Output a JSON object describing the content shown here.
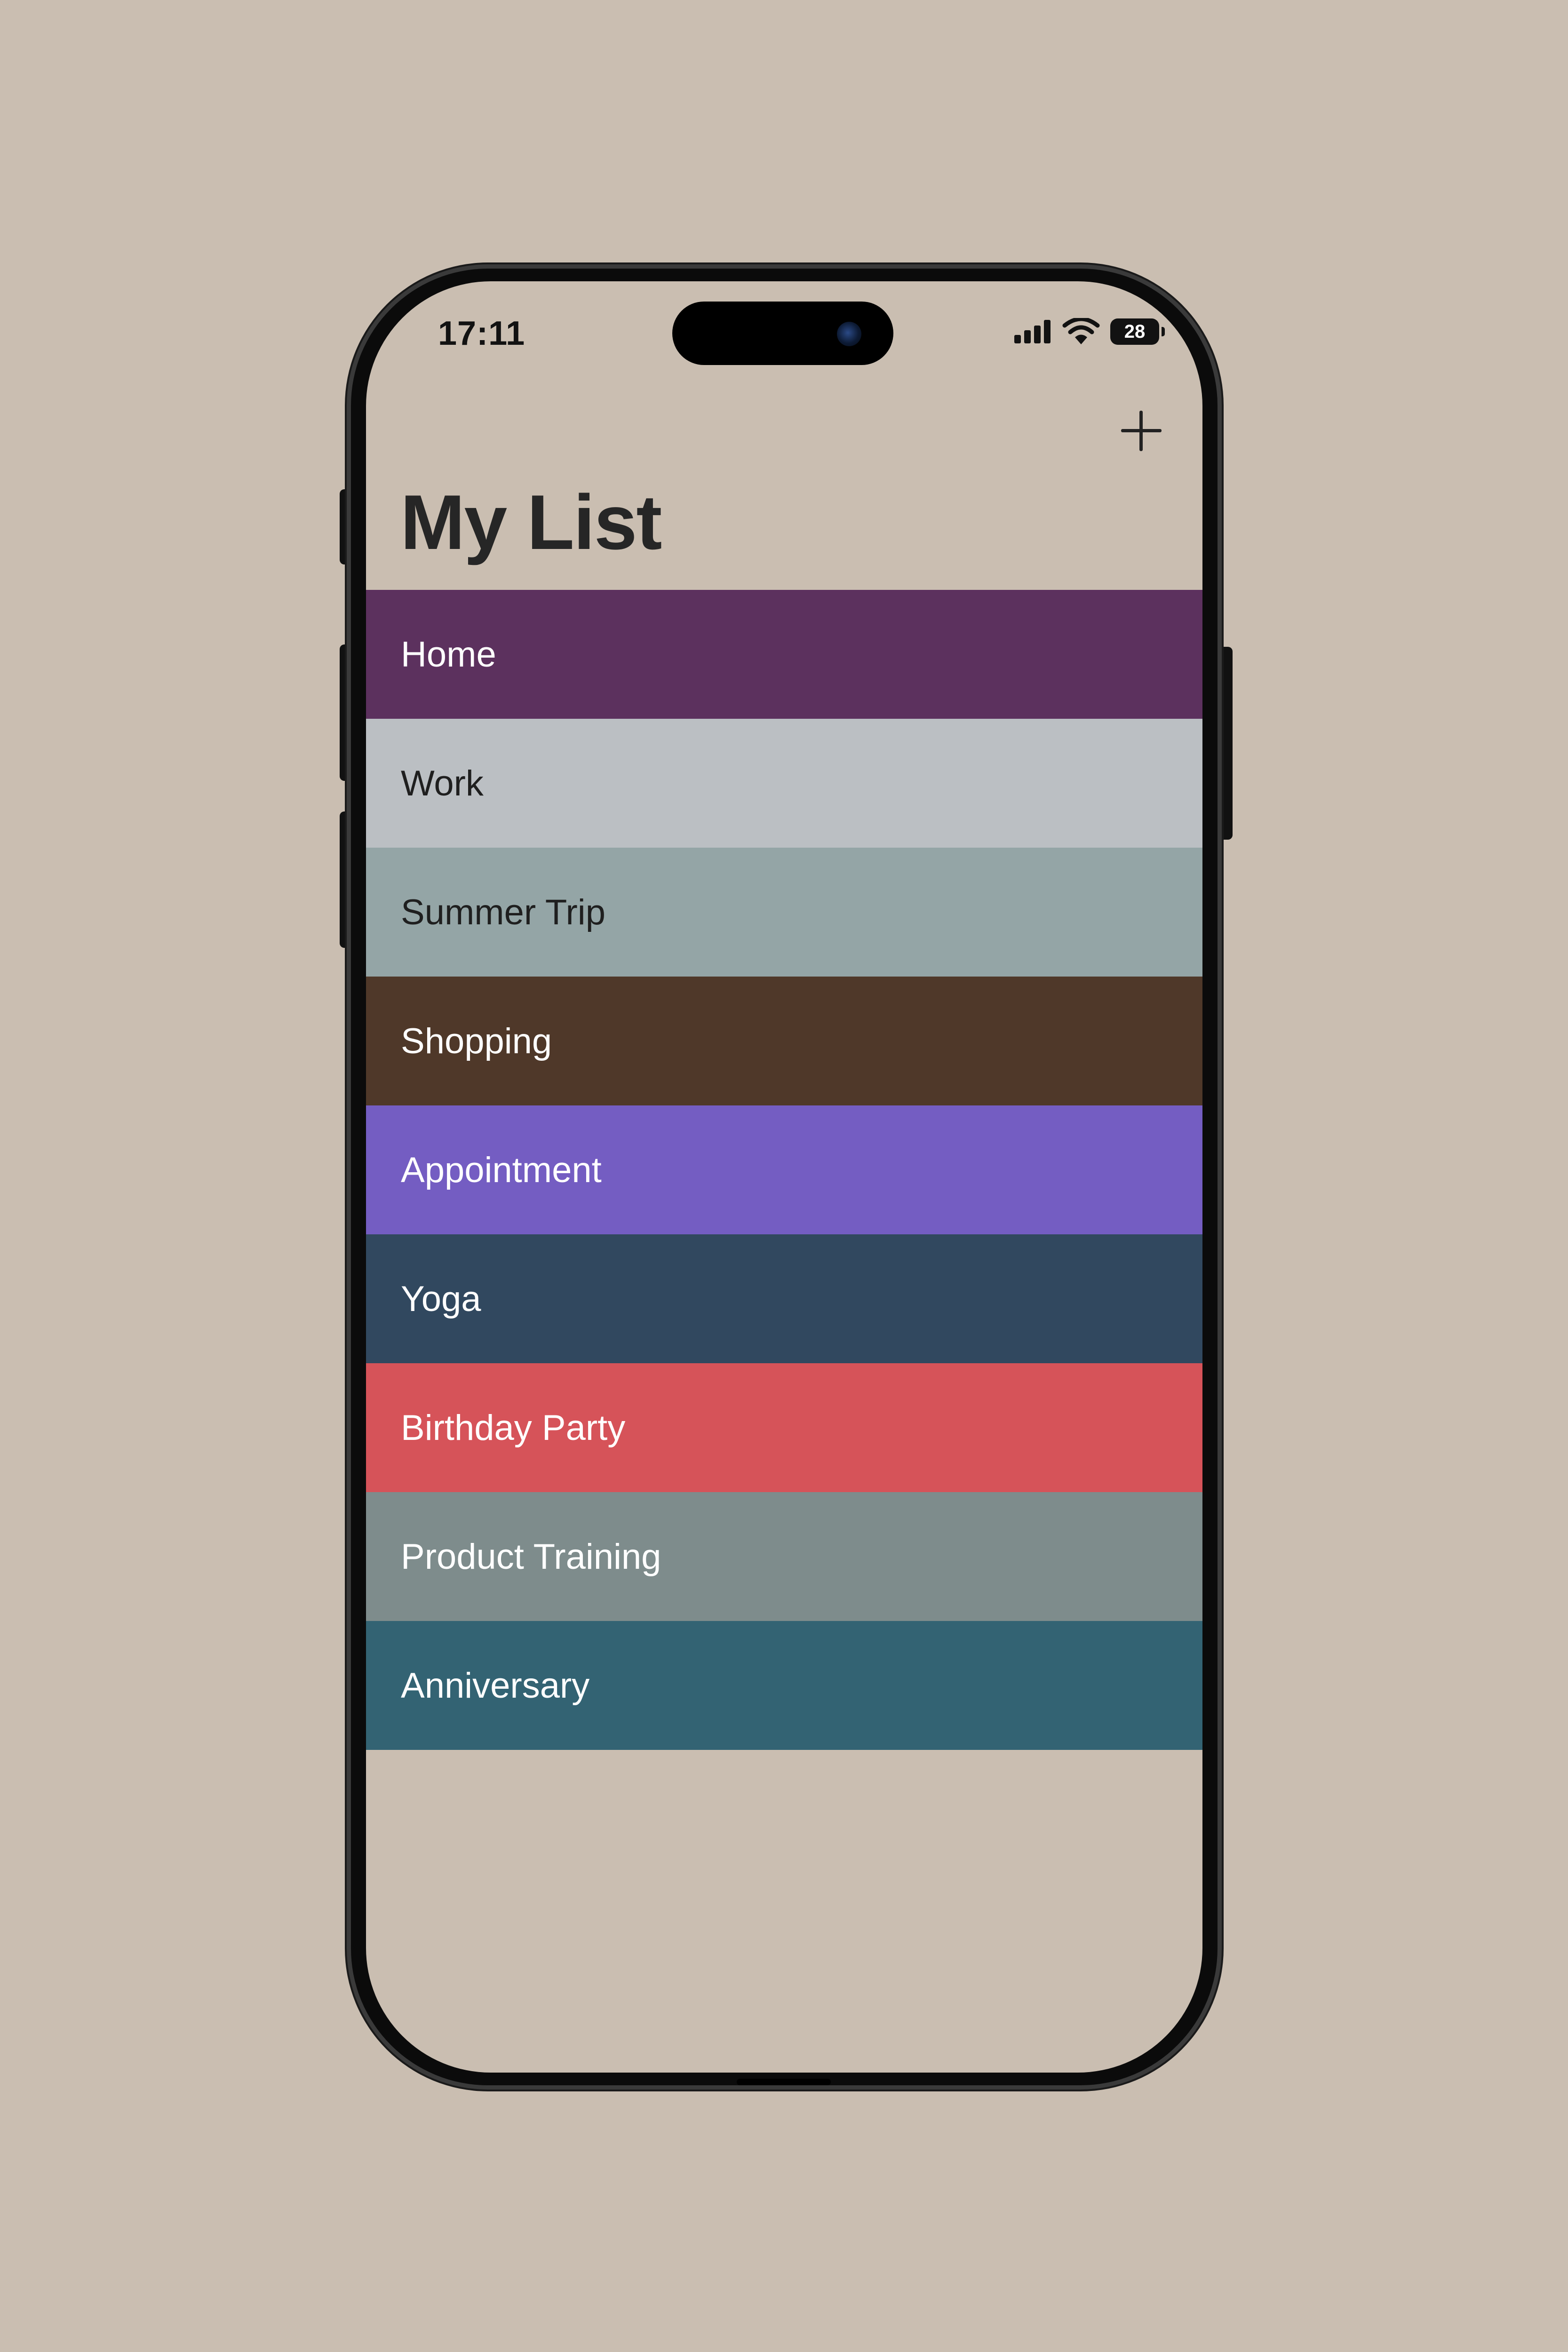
{
  "status_bar": {
    "time": "17:11",
    "battery_level": "28",
    "signal_icon": "cellular-signal-icon",
    "wifi_icon": "wifi-icon",
    "battery_icon": "battery-icon"
  },
  "nav": {
    "add_icon": "plus-icon",
    "title": "My List"
  },
  "list": {
    "items": [
      {
        "label": "Home",
        "bg": "#5c315e",
        "fg": "#ffffff"
      },
      {
        "label": "Work",
        "bg": "#bbbfc3",
        "fg": "#1f1f1f"
      },
      {
        "label": "Summer Trip",
        "bg": "#94a5a6",
        "fg": "#1f1f1f"
      },
      {
        "label": "Shopping",
        "bg": "#4f3829",
        "fg": "#ffffff"
      },
      {
        "label": "Appointment",
        "bg": "#745dc2",
        "fg": "#ffffff"
      },
      {
        "label": "Yoga",
        "bg": "#31485f",
        "fg": "#ffffff"
      },
      {
        "label": "Birthday Party",
        "bg": "#d65359",
        "fg": "#ffffff"
      },
      {
        "label": "Product Training",
        "bg": "#7e8c8c",
        "fg": "#ffffff"
      },
      {
        "label": "Anniversary",
        "bg": "#336373",
        "fg": "#ffffff"
      }
    ]
  },
  "colors": {
    "background": "#cabeb1",
    "title": "#262626"
  }
}
